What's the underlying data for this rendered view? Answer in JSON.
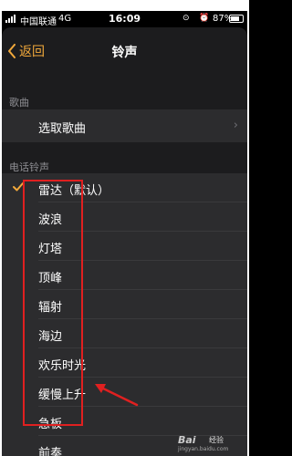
{
  "status_bar": {
    "carrier": "中国联通",
    "network": "4G",
    "time": "16:09",
    "battery_pct": "87%"
  },
  "nav": {
    "back_label": "返回",
    "title": "铃声"
  },
  "sections": {
    "songs_header": "歌曲",
    "pick_song": "选取歌曲",
    "ringtones_header": "电话铃声"
  },
  "ringtones": [
    "雷达（默认）",
    "波浪",
    "灯塔",
    "顶峰",
    "辐射",
    "海边",
    "欢乐时光",
    "缓慢上升",
    "急板",
    "前奏"
  ],
  "selected_ringtone": "雷达（默认）",
  "watermark": {
    "logo": "Bai",
    "text": "经验",
    "url": "jingyan.baidu.com"
  },
  "colors": {
    "accent": "#f2a93b",
    "highlight": "#e02020",
    "background": "#1c1c1e",
    "cell": "#2c2c2e"
  }
}
